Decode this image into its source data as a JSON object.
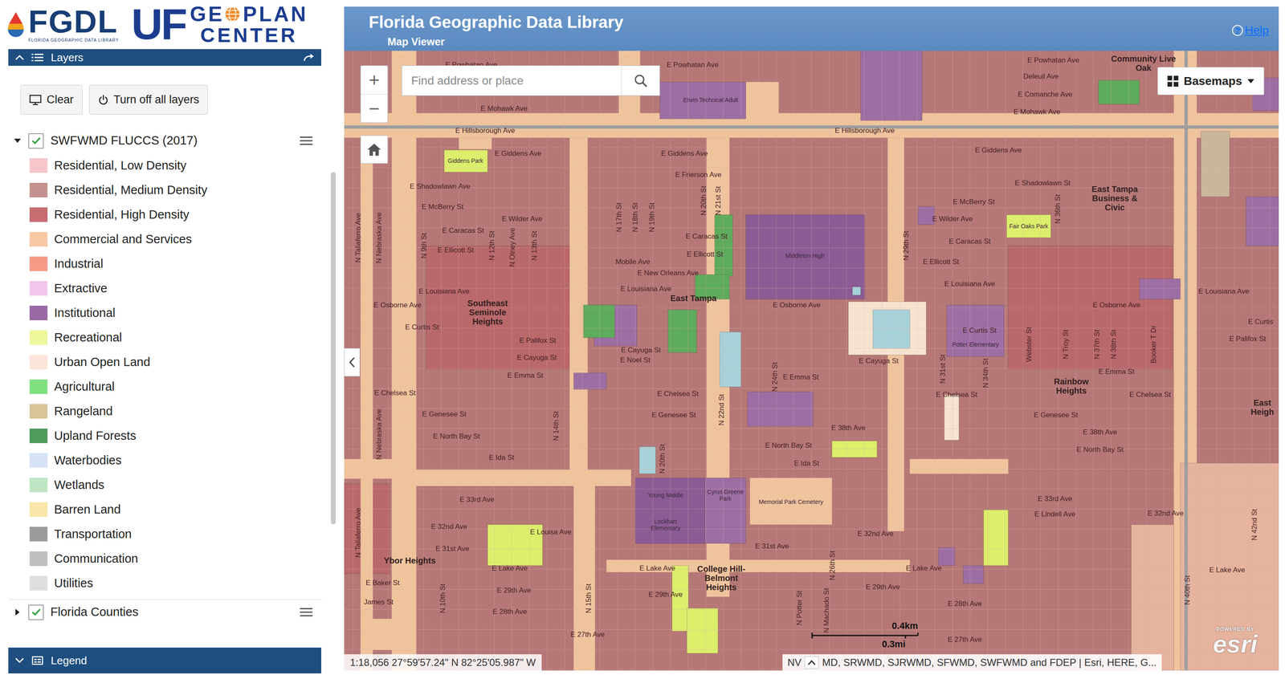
{
  "header": {
    "fgdl": {
      "name": "FGDL",
      "subtitle": "FLORIDA GEOGRAPHIC DATA LIBRARY"
    },
    "geoplan": {
      "uf": "UF",
      "left": "GE",
      "right": "PLAN",
      "second_line": "CENTER"
    },
    "title": "Florida Geographic Data Library",
    "subtitle": "Map Viewer",
    "help": {
      "icon": "?",
      "label": "Help"
    }
  },
  "layers_panel": {
    "title": "Layers",
    "expanded": true,
    "buttons": [
      {
        "label": "Clear"
      },
      {
        "label": "Turn off all layers"
      }
    ],
    "layers": [
      {
        "name": "SWFWMD FLUCCS (2017)",
        "checked": true,
        "expanded": true,
        "legend": [
          {
            "label": "Residential, Low Density",
            "color": "#f6c6cb"
          },
          {
            "label": "Residential, Medium Density",
            "color": "#c4928e"
          },
          {
            "label": "Residential, High Density",
            "color": "#c76d6f"
          },
          {
            "label": "Commercial and Services",
            "color": "#f8c9a4"
          },
          {
            "label": "Industrial",
            "color": "#f79a85"
          },
          {
            "label": "Extractive",
            "color": "#f3c5ec"
          },
          {
            "label": "Institutional",
            "color": "#9b68a6"
          },
          {
            "label": "Recreational",
            "color": "#eef69c"
          },
          {
            "label": "Urban Open Land",
            "color": "#fde4da"
          },
          {
            "label": "Agricultural",
            "color": "#80e080"
          },
          {
            "label": "Rangeland",
            "color": "#d9c398"
          },
          {
            "label": "Upland Forests",
            "color": "#4f9b5c"
          },
          {
            "label": "Waterbodies",
            "color": "#d5e3f5"
          },
          {
            "label": "Wetlands",
            "color": "#c0e5c5"
          },
          {
            "label": "Barren Land",
            "color": "#f8e7a8"
          },
          {
            "label": "Transportation",
            "color": "#9a9a9a"
          },
          {
            "label": "Communication",
            "color": "#bebebe"
          },
          {
            "label": "Utilities",
            "color": "#dedede"
          }
        ]
      },
      {
        "name": "Florida Counties",
        "checked": true,
        "expanded": false,
        "legend": []
      }
    ]
  },
  "legend_panel": {
    "title": "Legend",
    "expanded": false
  },
  "map": {
    "search": {
      "placeholder": "Find address or place"
    },
    "zoom": {
      "in": "+",
      "out": "−"
    },
    "basemaps": {
      "label": "Basemaps",
      "expanded": false
    },
    "scale": {
      "km": "0.4km",
      "mi": "0.3mi"
    },
    "status": "1:18,056 27°59'57.24\" N 82°25'05.987\" W",
    "attribution": {
      "lead": "NV",
      "text": "MD, SRWMD, SJRWMD, SFWMD, SWFWMD and FDEP | Esri, HERE, G..."
    },
    "esri": {
      "powered": "POWERED BY",
      "name": "esri"
    },
    "labels": {
      "streets": [
        "E Powhatan Ave",
        "E Powhatan Ave",
        "E Powhatan Ave",
        "Deleuil Ave",
        "E Comanche Ave",
        "E Mohawk Ave",
        "E Mohawk Ave",
        "E Hillsborough Ave",
        "E Hillsborough Ave",
        "E Giddens Ave",
        "E Giddens Ave",
        "E Giddens Ave",
        "E Shadowlawn Ave",
        "E Frierson Ave",
        "E Shadowlawn St",
        "E McBerry St",
        "E McBerry St",
        "E Wilder Ave",
        "E Wilder Ave",
        "E Caracas St",
        "E Caracas St",
        "E Caracas St",
        "E Ellicott St",
        "E Ellicott St",
        "E Ellicott St",
        "Mobile Ave",
        "E New Orleans Ave",
        "E Louisiana Ave",
        "E Louisiana Ave",
        "E Louisiana Ave",
        "E Louisiana Ave",
        "E Osborne Ave",
        "E Osborne Ave",
        "E Osborne Ave",
        "E Curtis St",
        "E Curtis St",
        "E Curtis",
        "E Palifox St",
        "E Palifox St",
        "E Cayuga St",
        "E Cayuga St",
        "E Noel St",
        "E Cayuga St",
        "E Emma St",
        "E Emma St",
        "E Emma St",
        "E Chelsea St",
        "E Chelsea St",
        "E Chelsea St",
        "E Chelsea St",
        "E Genesee St",
        "E Genesee St",
        "E Genesee St",
        "E North Bay St",
        "E 38th Ave",
        "E North Bay St",
        "E 38th Ave",
        "E North Bay St",
        "E Ida St",
        "E Ida St",
        "E 33rd Ave",
        "E 33rd Ave",
        "E Lindell Ave",
        "E 32nd Ave",
        "E 32nd Ave",
        "E Louisa Ave",
        "E 32nd Ave",
        "E 31st Ave",
        "E 31st Ave",
        "E Lake Ave",
        "E Lake Ave",
        "E Lake Ave",
        "E Lake Ave",
        "E Baker St",
        "James St",
        "E 29th Ave",
        "E 29th Ave",
        "E 29th Ave",
        "E 28th Ave",
        "E 28th Ave",
        "E 27th Ave",
        "E 27th Ave"
      ],
      "cross_streets": [
        "N Taliaferro Ave",
        "N Taliaferro Ave",
        "N Nebraska Ave",
        "N Nebraska Ave",
        "N 9th St",
        "N 10th St",
        "N 12th St",
        "N Olney Ave",
        "N 13th St",
        "N 14th St",
        "N 15th St",
        "N 17th St",
        "N 18th St",
        "N 19th St",
        "N 20th St",
        "N 21st St",
        "N 22nd St",
        "N 20th St",
        "N 24th St",
        "N 26th St",
        "N Potter St",
        "N Machado St",
        "N 29th St",
        "N 31st St",
        "N 34th St",
        "Webster St",
        "N Troy St",
        "N 36th St",
        "N 37th St",
        "N 38th St",
        "Booker T Dr",
        "N 40th St",
        "N 42nd St"
      ],
      "places": [
        "Southeast Seminole Heights",
        "East Tampa",
        "East Tampa Business & Civic",
        "Rainbow Heights",
        "Ybor Heights",
        "College Hill-Belmont Heights",
        "East Heigh",
        "Community Live Oak"
      ],
      "pois": [
        "Giddens Park",
        "Fair Oaks Park",
        "Middleton High",
        "Potter Elementary",
        "Young Middle",
        "Lockhart Elementary",
        "Cyrus Greene Park",
        "Memorial Park Cemetery",
        "Erwin Technical Adult"
      ]
    }
  }
}
